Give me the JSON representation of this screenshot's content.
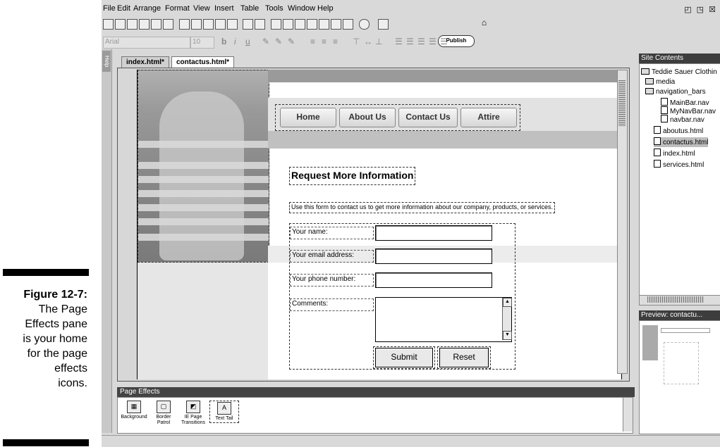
{
  "caption": {
    "figure_label": "Figure 12-7:",
    "lines": [
      "The Page",
      "Effects pane",
      "is your home",
      "for the page",
      "effects",
      "icons."
    ]
  },
  "menubar": {
    "items": [
      "File",
      "Edit",
      "Arrange",
      "Format",
      "View",
      "Insert",
      "Table",
      "Tools",
      "Window",
      "Help"
    ],
    "window_controls": "◰ ◳ ☒"
  },
  "toolbar": {
    "publish_label": "Publish",
    "font_name": "Arial",
    "font_size": "10"
  },
  "help_tab": "Help",
  "doc_tabs": [
    {
      "label": "index.html*",
      "active": false
    },
    {
      "label": "contactus.html*",
      "active": true
    }
  ],
  "page": {
    "nav": [
      "Home",
      "About Us",
      "Contact Us",
      "Attire"
    ],
    "heading": "Request More Information",
    "intro": "Use this form to contact us to get more information about our company, products, or services.",
    "form": {
      "name_label": "Your name:",
      "email_label": "Your email address:",
      "phone_label": "Your phone number:",
      "comments_label": "Comments:",
      "submit_label": "Submit",
      "reset_label": "Reset"
    }
  },
  "site_contents": {
    "title": "Site Contents",
    "items": [
      {
        "label": "Teddie Sauer Clothin",
        "kind": "root"
      },
      {
        "label": "media",
        "kind": "folder"
      },
      {
        "label": "navigation_bars",
        "kind": "folder"
      },
      {
        "label": "MainBar.nav",
        "kind": "nav"
      },
      {
        "label": "MyNavBar.nav",
        "kind": "nav"
      },
      {
        "label": "navbar.nav",
        "kind": "nav"
      },
      {
        "label": "aboutus.html",
        "kind": "page"
      },
      {
        "label": "contactus.html",
        "kind": "page",
        "selected": true
      },
      {
        "label": "index.html",
        "kind": "page"
      },
      {
        "label": "services.html",
        "kind": "page"
      }
    ]
  },
  "preview": {
    "title": "Preview: contactu..."
  },
  "page_effects": {
    "title": "Page Effects",
    "items": [
      {
        "label": "Background",
        "icon": "grid-icon"
      },
      {
        "label": "Border Patrol",
        "icon": "border-icon"
      },
      {
        "label": "IE Page Transitions",
        "icon": "transition-icon"
      },
      {
        "label": "Text Tail",
        "icon": "text-tail-icon",
        "selected": true
      }
    ]
  }
}
